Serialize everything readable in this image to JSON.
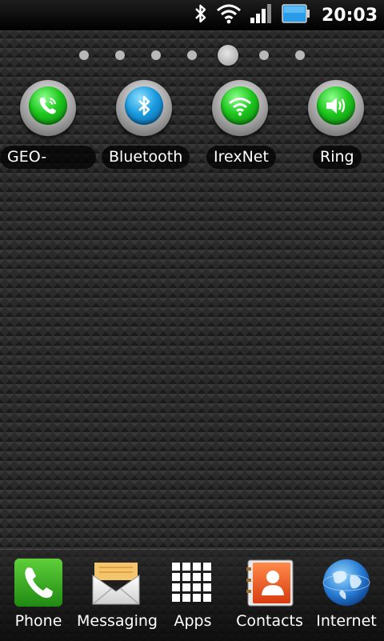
{
  "status_bar": {
    "time": "20:03",
    "icons": [
      "bluetooth-icon",
      "wifi-icon",
      "signal-icon",
      "battery-icon"
    ]
  },
  "home": {
    "page_count": 7,
    "active_page": 5,
    "toggles": [
      {
        "label": "GEO-",
        "icon": "phone-icon",
        "color": "#1ec81e"
      },
      {
        "label": "Bluetooth",
        "icon": "bluetooth-icon",
        "color": "#1a9ce0"
      },
      {
        "label": "IrexNet",
        "icon": "wifi-icon",
        "color": "#1ec81e"
      },
      {
        "label": "Ring",
        "icon": "speaker-icon",
        "color": "#1ec81e"
      }
    ]
  },
  "dock": {
    "items": [
      {
        "label": "Phone",
        "icon": "phone-icon"
      },
      {
        "label": "Messaging",
        "icon": "envelope-icon"
      },
      {
        "label": "Apps",
        "icon": "app-grid-icon"
      },
      {
        "label": "Contacts",
        "icon": "contacts-icon"
      },
      {
        "label": "Internet",
        "icon": "globe-icon"
      }
    ]
  }
}
